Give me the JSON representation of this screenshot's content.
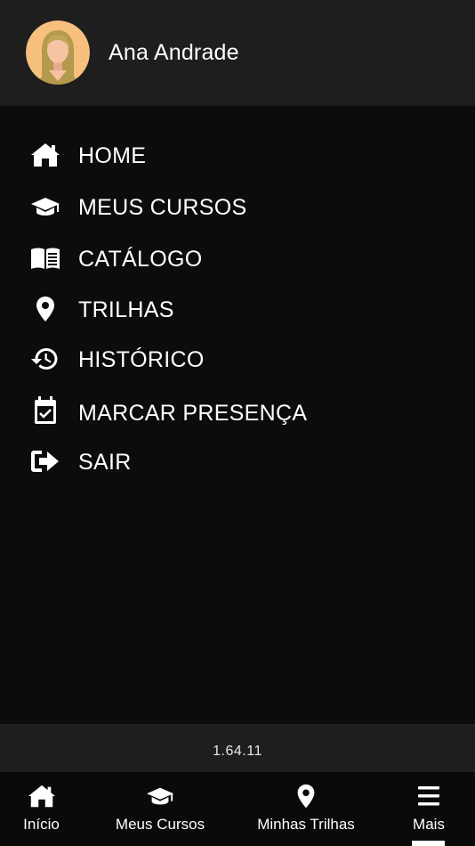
{
  "user": {
    "name": "Ana Andrade",
    "avatar_icon": "female-avatar-icon"
  },
  "menu": {
    "items": [
      {
        "label": "HOME",
        "icon": "home-icon"
      },
      {
        "label": "MEUS CURSOS",
        "icon": "graduation-cap-icon"
      },
      {
        "label": "CATÁLOGO",
        "icon": "open-book-icon"
      },
      {
        "label": "TRILHAS",
        "icon": "location-pin-icon"
      },
      {
        "label": "HISTÓRICO",
        "icon": "history-icon"
      },
      {
        "label": "MARCAR PRESENÇA",
        "icon": "calendar-check-icon"
      },
      {
        "label": "SAIR",
        "icon": "logout-icon"
      }
    ]
  },
  "version": "1.64.11",
  "bottom_nav": {
    "items": [
      {
        "label": "Início",
        "icon": "home-icon"
      },
      {
        "label": "Meus Cursos",
        "icon": "graduation-cap-icon"
      },
      {
        "label": "Minhas Trilhas",
        "icon": "location-pin-icon"
      },
      {
        "label": "Mais",
        "icon": "hamburger-menu-icon",
        "active": true
      }
    ]
  },
  "colors": {
    "background": "#0c0c0d",
    "header": "#1e1e1f",
    "text": "#ffffff",
    "avatar_bg": "#f8c07f",
    "hair": "#b49a4c",
    "skin": "#f6c4a3"
  }
}
